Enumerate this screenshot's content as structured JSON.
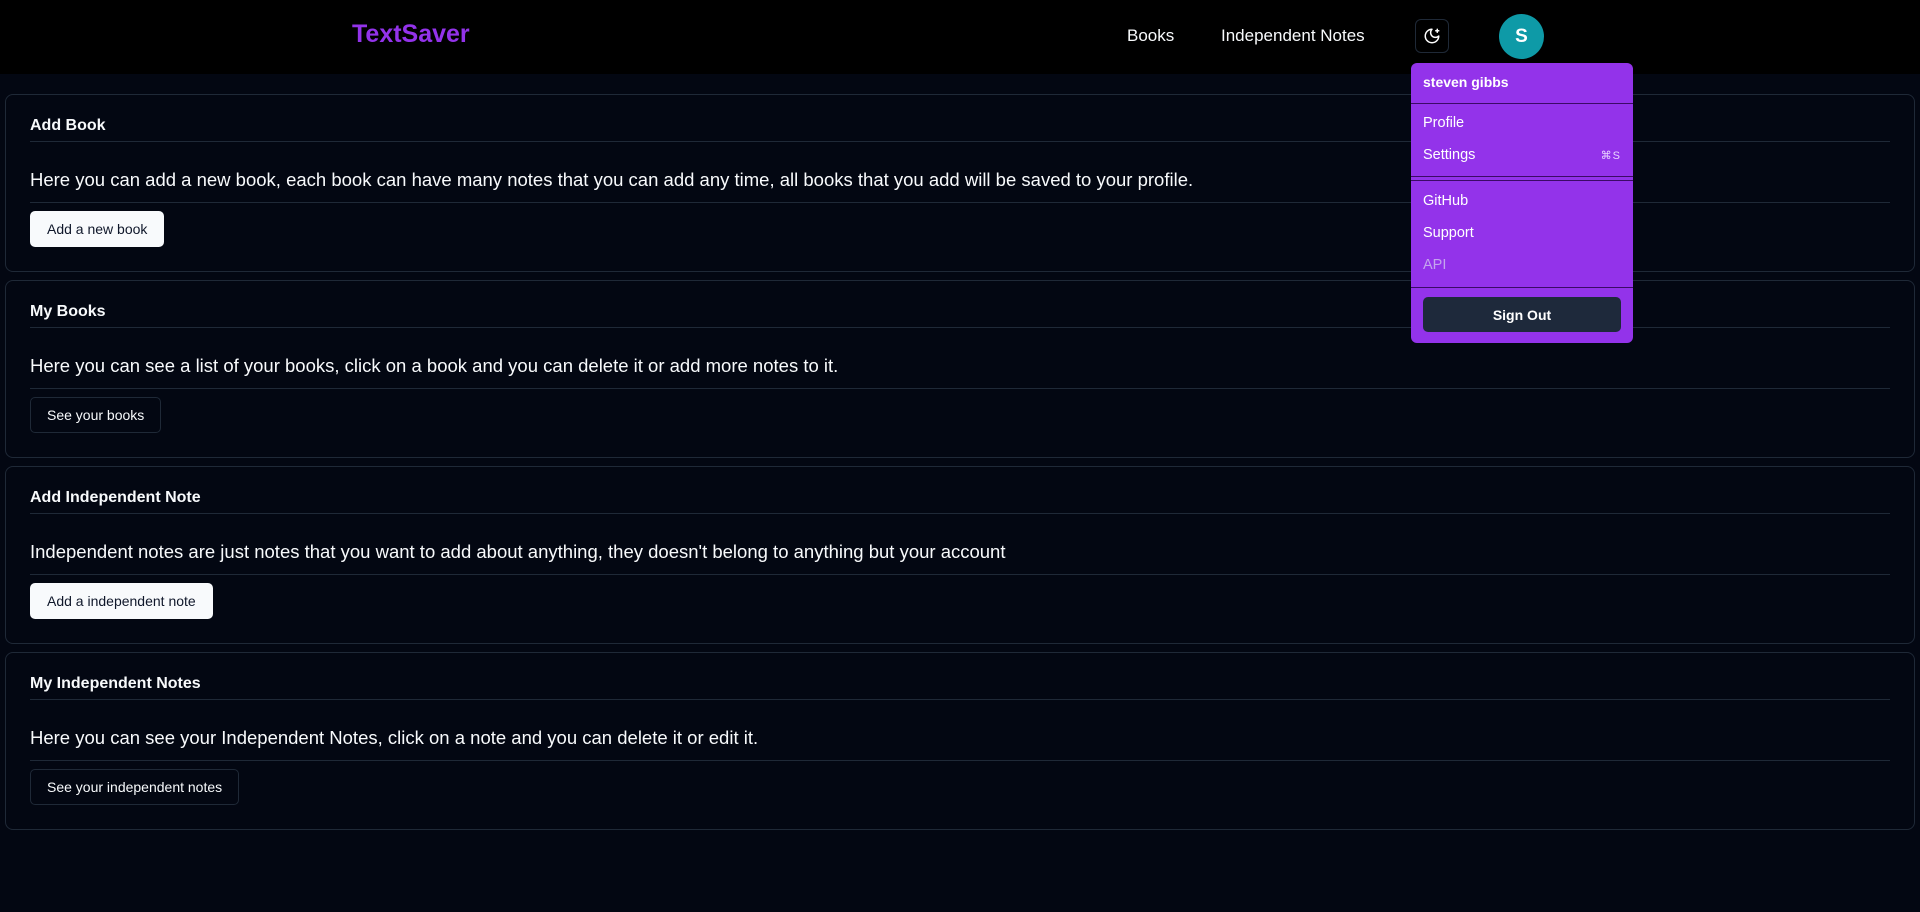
{
  "header": {
    "brand": "TextSaver",
    "nav": [
      {
        "label": "Books"
      },
      {
        "label": "Independent Notes"
      }
    ],
    "theme_toggle_icon": "moon-sparkle-icon",
    "avatar_initial": "S",
    "avatar_color": "#0e9aa7"
  },
  "cards": [
    {
      "title": "Add Book",
      "description": "Here you can add a new book, each book can have many notes that you can add any time, all books that you add will be saved to your profile.",
      "button": "Add a new book"
    },
    {
      "title": "My Books",
      "description": "Here you can see a list of your books, click on a book and you can delete it or add more notes to it.",
      "button": "See your books"
    },
    {
      "title": "Add Independent Note",
      "description": "Independent notes are just notes that you want to add about anything, they doesn't belong to anything but your account",
      "button": "Add a independent note"
    },
    {
      "title": "My Independent Notes",
      "description": "Here you can see your Independent Notes, click on a note and you can delete it or edit it.",
      "button": "See your independent notes"
    }
  ],
  "dropdown": {
    "user_name": "steven gibbs",
    "items": {
      "profile": "Profile",
      "settings": "Settings",
      "settings_shortcut": "⌘S",
      "github": "GitHub",
      "support": "Support",
      "api": "API"
    },
    "sign_out": "Sign Out"
  },
  "colors": {
    "background": "#030712",
    "navbar": "#000000",
    "brand": "#9333ea",
    "dropdown": "#9333ea",
    "sign_out_button": "#1e293b"
  }
}
